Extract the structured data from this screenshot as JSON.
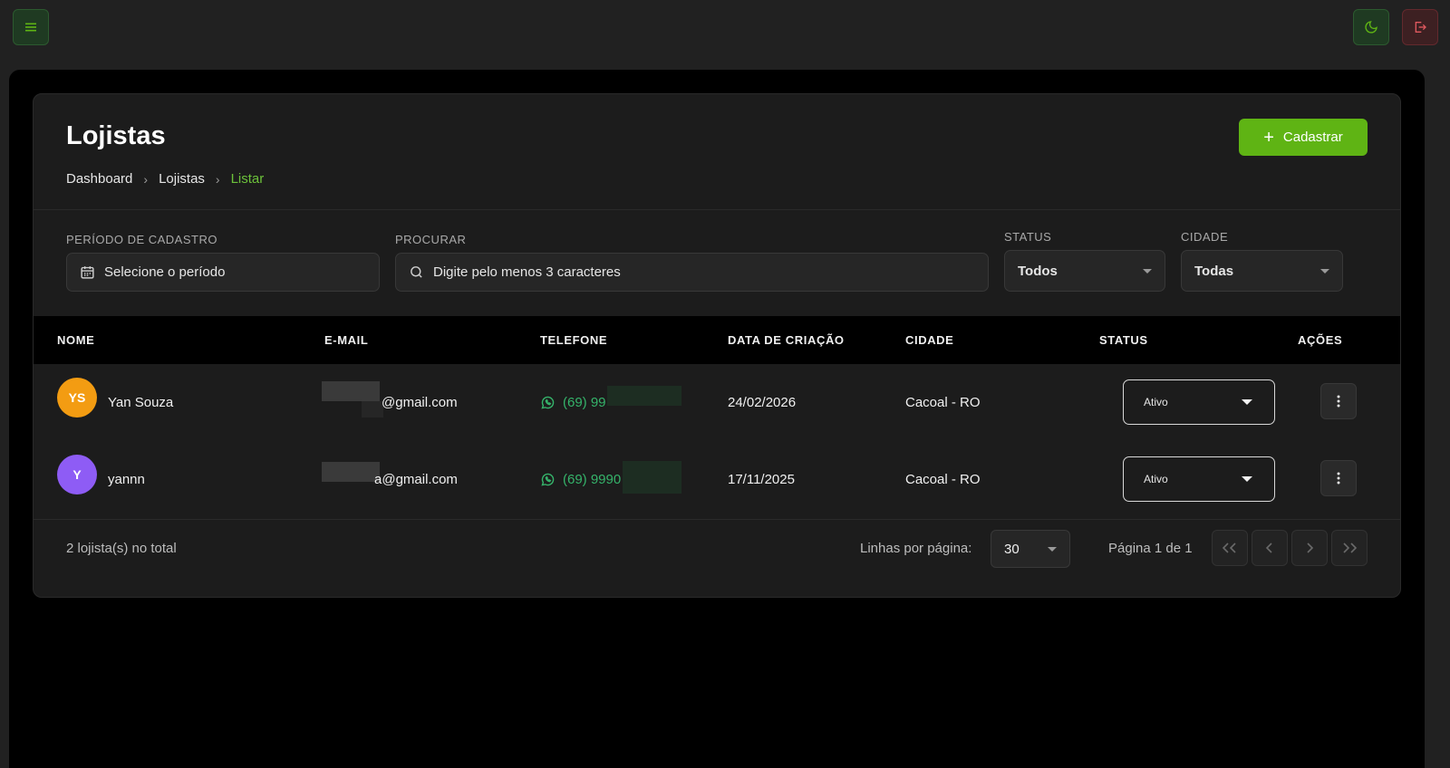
{
  "topbar": {
    "menu_icon": "hamburger-icon",
    "theme_icon": "moon-icon",
    "logout_icon": "logout-icon"
  },
  "page": {
    "title": "Lojistas",
    "breadcrumb": [
      "Dashboard",
      "Lojistas",
      "Listar"
    ],
    "create_button": "Cadastrar"
  },
  "filters": {
    "period_label": "PERÍODO DE CADASTRO",
    "period_placeholder": "Selecione o período",
    "search_label": "PROCURAR",
    "search_placeholder": "Digite pelo menos 3 caracteres",
    "status_label": "STATUS",
    "status_value": "Todos",
    "city_label": "CIDADE",
    "city_value": "Todas"
  },
  "table": {
    "columns": [
      "NOME",
      "E-MAIL",
      "TELEFONE",
      "DATA DE CRIAÇÃO",
      "CIDADE",
      "STATUS",
      "AÇÕES"
    ],
    "rows": [
      {
        "initials": "YS",
        "avatar_color": "#f39c12",
        "name": "Yan Souza",
        "email": "@gmail.com",
        "phone": "(69) 99",
        "created": "24/02/2026",
        "city": "Cacoal - RO",
        "status": "Ativo"
      },
      {
        "initials": "Y",
        "avatar_color": "#8e5cf5",
        "name": "yannn",
        "email": "a@gmail.com",
        "phone": "(69) 9990",
        "created": "17/11/2025",
        "city": "Cacoal - RO",
        "status": "Ativo"
      }
    ]
  },
  "footer": {
    "total": "2 lojista(s) no total",
    "rows_per_page_label": "Linhas por página:",
    "rows_per_page": "30",
    "page_info": "Página 1 de 1"
  },
  "colors": {
    "accent": "#5fb414",
    "breadcrumb_active": "#6cc13a",
    "whatsapp": "#35b36a"
  }
}
